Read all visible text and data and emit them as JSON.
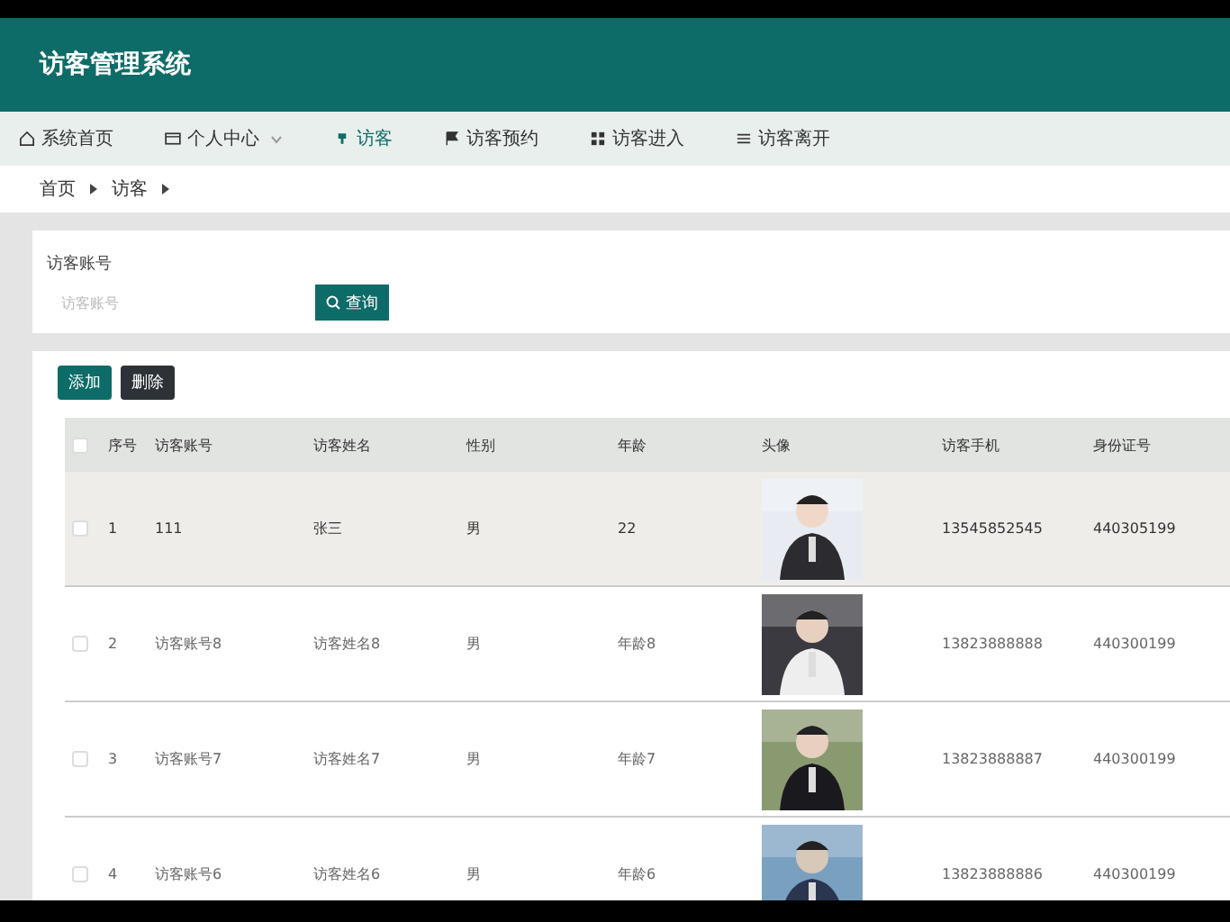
{
  "header": {
    "title": "访客管理系统"
  },
  "nav": [
    {
      "label": "系统首页",
      "dropdown": false,
      "selected": false
    },
    {
      "label": "个人中心",
      "dropdown": true,
      "selected": false
    },
    {
      "label": "访客",
      "dropdown": false,
      "selected": true
    },
    {
      "label": "访客预约",
      "dropdown": false,
      "selected": false
    },
    {
      "label": "访客进入",
      "dropdown": false,
      "selected": false
    },
    {
      "label": "访客离开",
      "dropdown": false,
      "selected": false
    }
  ],
  "breadcrumb": [
    "首页",
    "访客"
  ],
  "search": {
    "label": "访客账号",
    "placeholder": "访客账号",
    "button": "查询"
  },
  "actions": [
    {
      "label": "添加",
      "kind": "add"
    },
    {
      "label": "删除",
      "kind": "delete"
    }
  ],
  "table": {
    "all_checked": false,
    "columns": [
      "序号",
      "访客账号",
      "访客姓名",
      "性别",
      "年龄",
      "头像",
      "访客手机",
      "身份证号"
    ],
    "rows": [
      {
        "checked": false,
        "highlighted": true,
        "cells": [
          "1",
          "111",
          "张三",
          "男",
          "22",
          "",
          "13545852545",
          "440305199"
        ]
      },
      {
        "checked": false,
        "highlighted": false,
        "cells": [
          "2",
          "访客账号8",
          "访客姓名8",
          "男",
          "年龄8",
          "",
          "13823888888",
          "440300199"
        ]
      },
      {
        "checked": false,
        "highlighted": false,
        "cells": [
          "3",
          "访客账号7",
          "访客姓名7",
          "男",
          "年龄7",
          "",
          "13823888887",
          "440300199"
        ]
      },
      {
        "checked": false,
        "highlighted": false,
        "cells": [
          "4",
          "访客账号6",
          "访客姓名6",
          "男",
          "年龄6",
          "",
          "13823888886",
          "440300199"
        ]
      }
    ]
  }
}
